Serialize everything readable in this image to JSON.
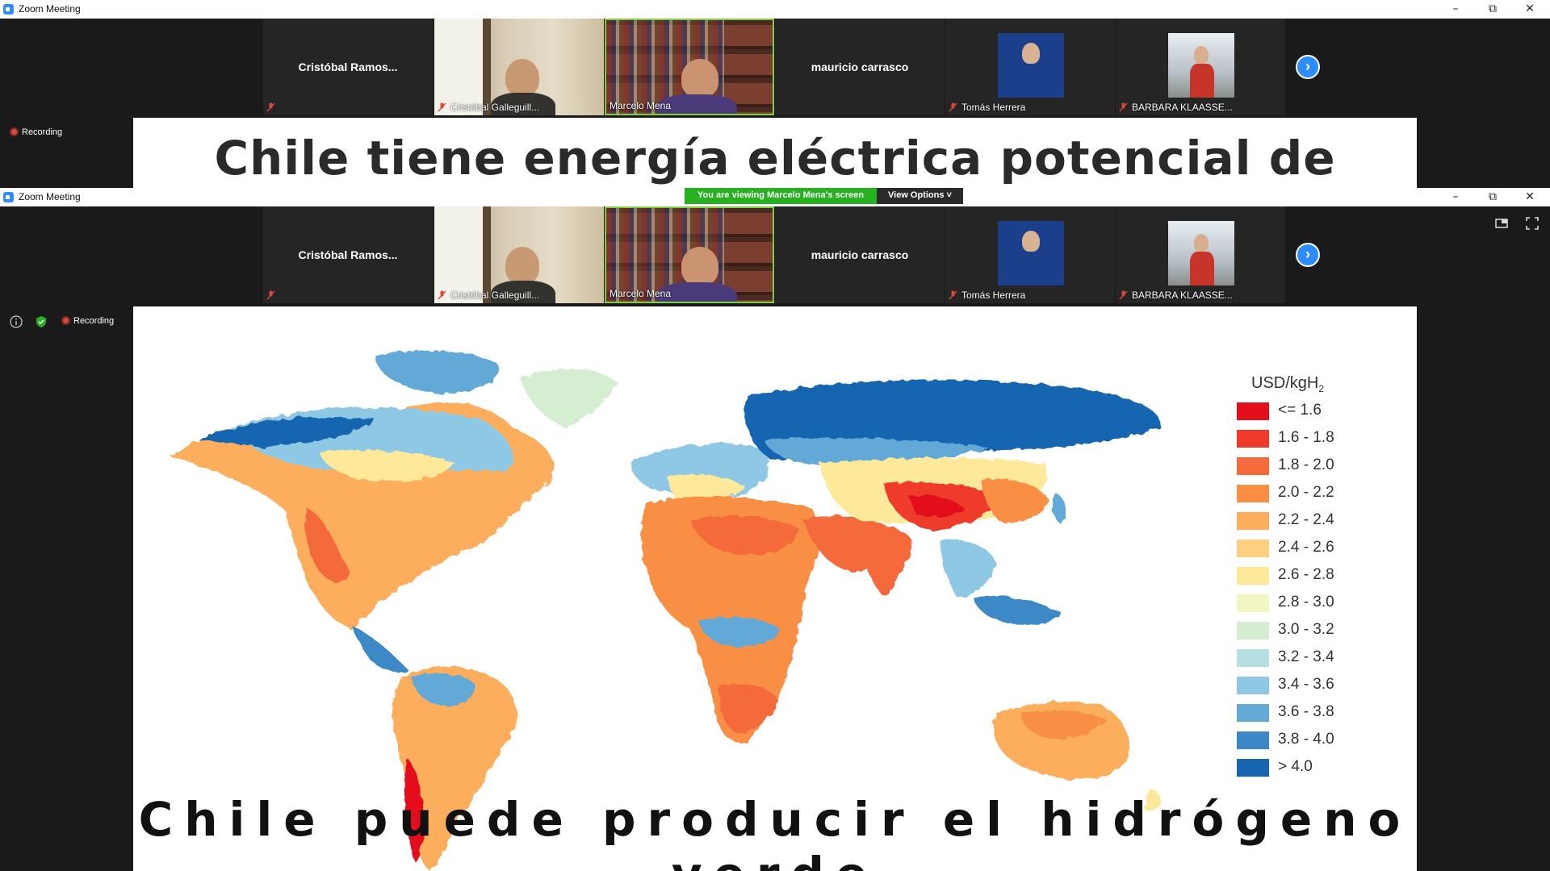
{
  "app": {
    "window_title": "Zoom Meeting"
  },
  "participants": [
    {
      "name": "Cristóbal  Ramos...",
      "video": false,
      "muted": true
    },
    {
      "name": "Cristóbal Galleguill...",
      "video": true,
      "muted": true
    },
    {
      "name": "Marcelo Mena",
      "video": true,
      "muted": false,
      "active_speaker": true
    },
    {
      "name": "mauricio carrasco",
      "video": false,
      "muted": false
    },
    {
      "name": "Tomás Herrera",
      "video": true,
      "muted": true
    },
    {
      "name": "BARBARA KLAASSE...",
      "video": true,
      "muted": true
    }
  ],
  "recording_label": "Recording",
  "share_banner": {
    "status": "You are viewing Marcelo Mena's screen",
    "options": "View Options"
  },
  "slide1": {
    "title": "Chile tiene energía eléctrica potencial de sobra."
  },
  "slide2": {
    "bottom_text": "Chile puede producir el hidrógeno verde",
    "legend": {
      "title": "USD/kgH",
      "title_sub": "2",
      "items": [
        {
          "label": "<= 1.6",
          "color": "#e3101b"
        },
        {
          "label": "1.6 - 1.8",
          "color": "#ef3b2c"
        },
        {
          "label": "1.8 - 2.0",
          "color": "#f46a3b"
        },
        {
          "label": "2.0 - 2.2",
          "color": "#f98f44"
        },
        {
          "label": "2.2 - 2.4",
          "color": "#fcae5c"
        },
        {
          "label": "2.4 - 2.6",
          "color": "#fdcf7f"
        },
        {
          "label": "2.6 - 2.8",
          "color": "#fee99a"
        },
        {
          "label": "2.8 - 3.0",
          "color": "#f2f6c3"
        },
        {
          "label": "3.0 - 3.2",
          "color": "#d5edd1"
        },
        {
          "label": "3.2 - 3.4",
          "color": "#b5dfe0"
        },
        {
          "label": "3.4 - 3.6",
          "color": "#8fc8e4"
        },
        {
          "label": "3.6 - 3.8",
          "color": "#63a9d8"
        },
        {
          "label": "3.8 - 4.0",
          "color": "#3c88c7"
        },
        {
          "label": "> 4.0",
          "color": "#1765b0"
        }
      ]
    }
  },
  "icons": {
    "info": "info-icon",
    "shield": "shield-icon",
    "next": "chevron-right-icon",
    "mic_muted": "mic-muted-icon"
  }
}
